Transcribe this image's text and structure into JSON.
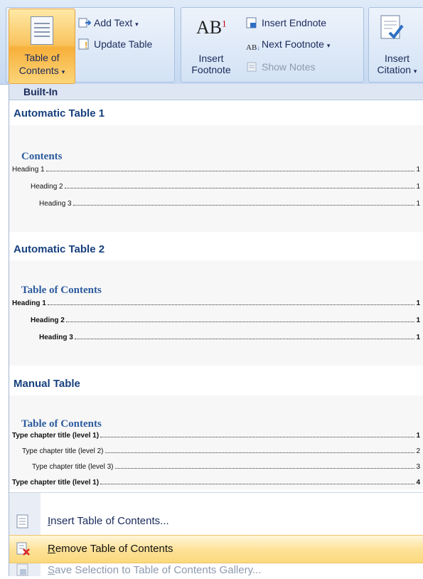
{
  "ribbon": {
    "table_of_contents": {
      "line1": "Table of",
      "line2": "Contents"
    },
    "add_text": "Add Text",
    "update_table": "Update Table",
    "insert_footnote": {
      "line1": "Insert",
      "line2": "Footnote"
    },
    "insert_endnote": "Insert Endnote",
    "next_footnote": "Next Footnote",
    "show_notes": "Show Notes",
    "insert_citation": {
      "line1": "Insert",
      "line2": "Citation"
    },
    "icons": [
      "table-of-contents-icon",
      "add-text-icon",
      "update-table-icon",
      "footnote-ab-icon",
      "endnote-icon",
      "next-footnote-icon",
      "show-notes-icon",
      "citation-icon"
    ]
  },
  "gallery": {
    "category": "Built-In",
    "items": [
      {
        "name": "Automatic Table 1",
        "preview_title": "Contents",
        "rows": [
          {
            "text": "Heading 1",
            "page": "1",
            "level": 1,
            "bold": false
          },
          {
            "text": "Heading 2",
            "page": "1",
            "level": 2,
            "bold": false
          },
          {
            "text": "Heading 3",
            "page": "1",
            "level": 3,
            "bold": false
          }
        ]
      },
      {
        "name": "Automatic Table 2",
        "preview_title": "Table of Contents",
        "rows": [
          {
            "text": "Heading 1",
            "page": "1",
            "level": 1,
            "bold": false
          },
          {
            "text": "Heading 2",
            "page": "1",
            "level": 2,
            "bold": false
          },
          {
            "text": "Heading 3",
            "page": "1",
            "level": 3,
            "bold": false
          }
        ]
      },
      {
        "name": "Manual Table",
        "preview_title": "Table of Contents",
        "rows": [
          {
            "text": "Type chapter title (level 1)",
            "page": "1",
            "level": 1,
            "bold": true
          },
          {
            "text": "Type chapter title (level 2)",
            "page": "2",
            "level": 2,
            "bold": false
          },
          {
            "text": "Type chapter title (level 3)",
            "page": "3",
            "level": 3,
            "bold": false
          },
          {
            "text": "Type chapter title (level 1)",
            "page": "4",
            "level": 1,
            "bold": true
          }
        ]
      }
    ]
  },
  "menu": {
    "insert_toc": "Insert Table of Contents...",
    "remove_toc": "Remove Table of Contents",
    "save_selection": "Save Selection to Table of Contents Gallery..."
  },
  "colors": {
    "highlight": "#fbd97c",
    "heading": "#17407e",
    "preview_title": "#2c5b9e"
  }
}
